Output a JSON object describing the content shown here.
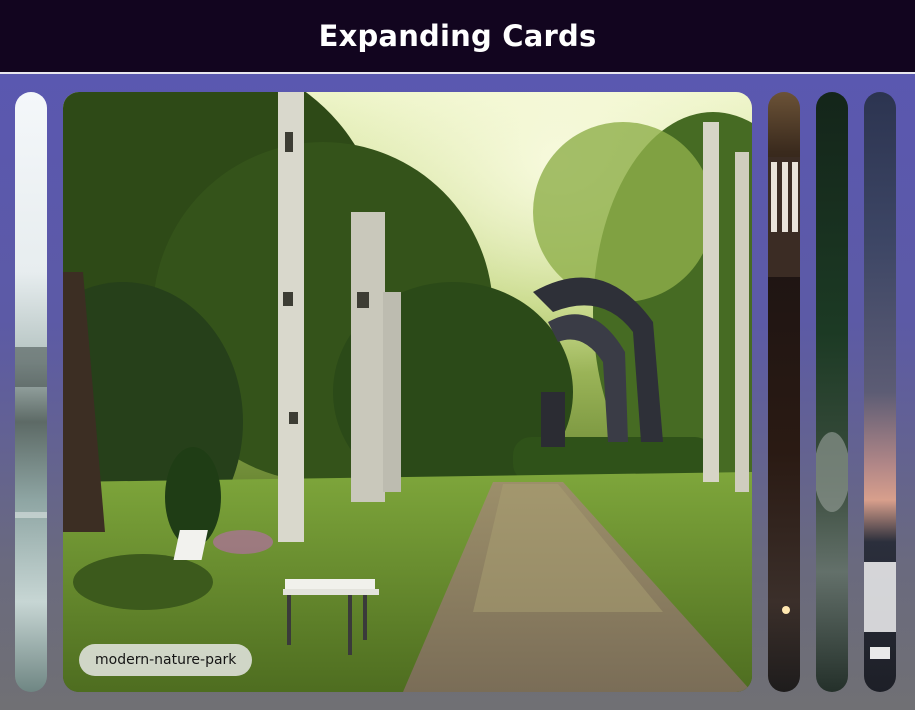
{
  "header": {
    "title": "Expanding Cards"
  },
  "cards": [
    {
      "label": "",
      "scene": "misty-lake-icon",
      "active": false
    },
    {
      "label": "modern-nature-park",
      "scene": "forest-path-icon",
      "active": true
    },
    {
      "label": "",
      "scene": "night-interior-icon",
      "active": false
    },
    {
      "label": "",
      "scene": "dark-forest-icon",
      "active": false
    },
    {
      "label": "",
      "scene": "sunset-water-icon",
      "active": false
    }
  ],
  "colors": {
    "header_bg": "#12051f",
    "body_gradient_top": "#5a57b3",
    "body_gradient_bottom": "#707074",
    "label_bg": "#ebebeb"
  }
}
